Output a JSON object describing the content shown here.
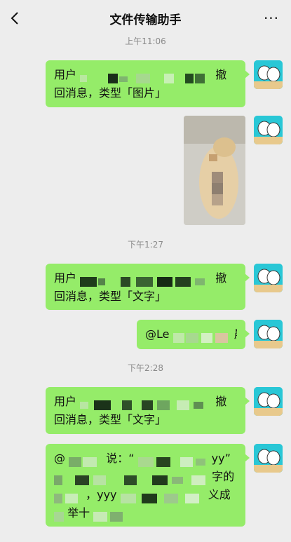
{
  "header": {
    "title": "文件传输助手",
    "back_icon": "chevron-left-icon",
    "more_icon": "more-dots-icon",
    "more_text": "···"
  },
  "colors": {
    "bubble_green": "#95ec69",
    "background": "#ededed",
    "avatar_bg": "#29c7d6",
    "timestamp": "#8a8a8a"
  },
  "messages": [
    {
      "timestamp": "上午11:06"
    },
    {
      "type": "text",
      "line1_start": "用户",
      "line1_end": "撤",
      "line2": "回消息，类型「图片」"
    },
    {
      "type": "image"
    },
    {
      "timestamp": "下午1:27"
    },
    {
      "type": "text",
      "line1_start": "用户",
      "line1_end": "撤",
      "line2": "回消息，类型「文字」"
    },
    {
      "type": "text",
      "line1_start": "@Le",
      "line1_end": "晨"
    },
    {
      "timestamp": "下午2:28"
    },
    {
      "type": "text",
      "line1_start": "用户",
      "line1_end": "撤",
      "line2": "回消息，类型「文字」"
    },
    {
      "type": "text",
      "line1_start": "@",
      "line1_mid": "说：“",
      "line1_end": "yy”",
      "line2_end": "字的",
      "line3_mid": "，yyy",
      "line3_end": "义成",
      "line4_start": "举十"
    }
  ]
}
